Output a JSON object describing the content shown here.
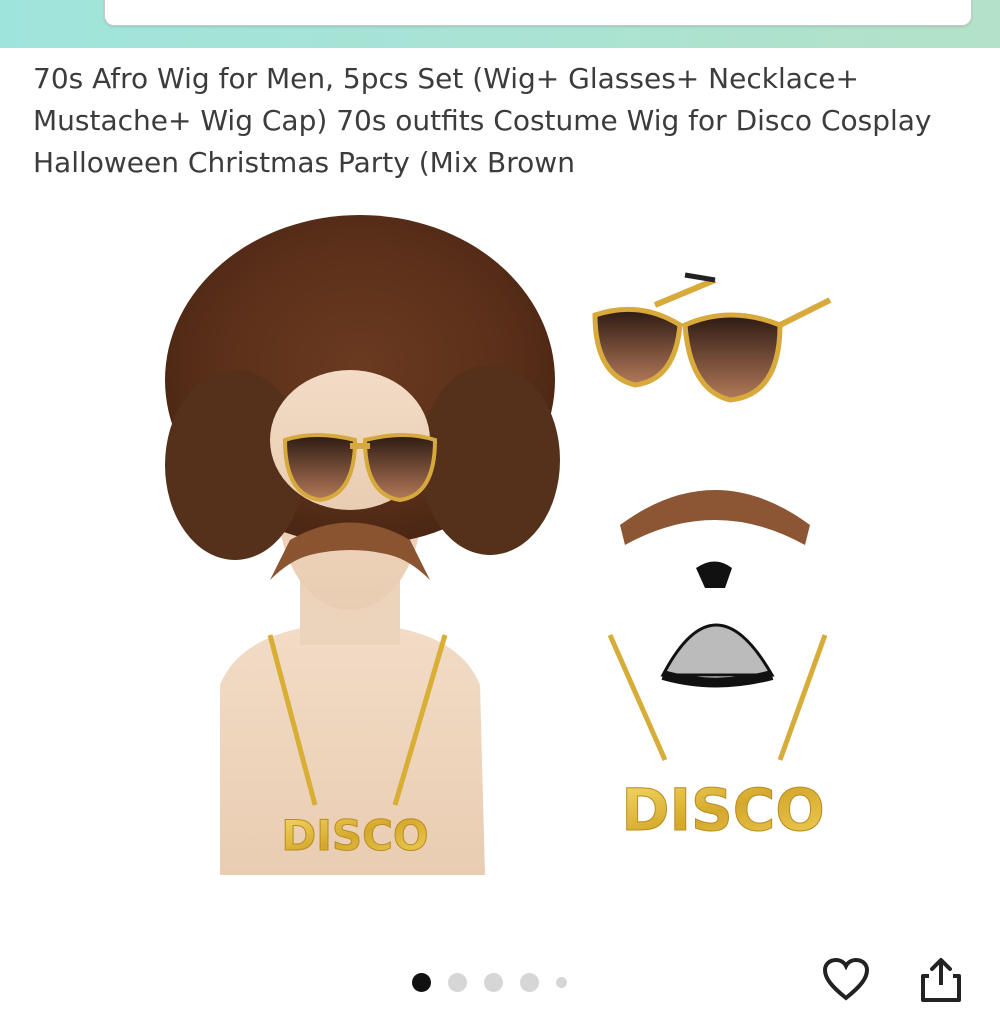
{
  "header": {
    "search_icon": "search-icon"
  },
  "product": {
    "title": "70s Afro Wig for Men, 5pcs Set (Wig+ Glasses+ Necklace+ Mustache+ Wig Cap) 70s outfits Costume Wig for Disco Cosplay Halloween Christmas Party (Mix Brown",
    "necklace_text_1": "DISCO",
    "necklace_text_2": "DISCO"
  },
  "gallery": {
    "image_count": 5,
    "active_index": 0
  },
  "actions": {
    "favorite_icon": "heart-icon",
    "share_icon": "share-icon"
  }
}
